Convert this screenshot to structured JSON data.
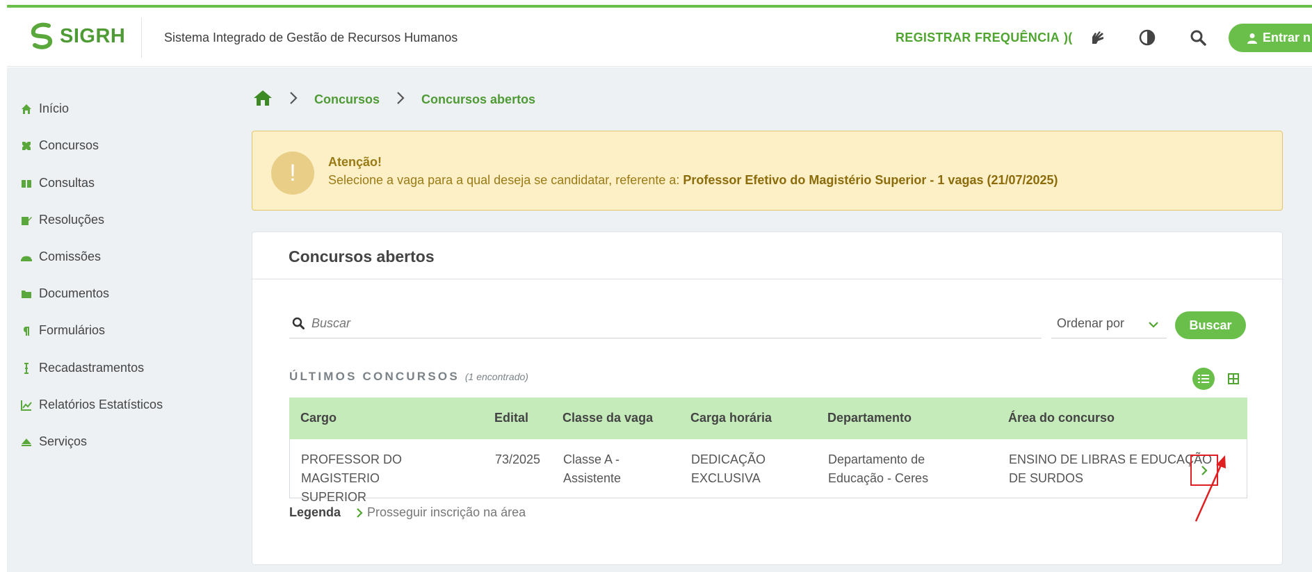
{
  "header": {
    "logo_text": "SIGRH",
    "system_name": "Sistema Integrado de Gestão de Recursos Humanos",
    "register_attendance": "REGISTRAR FREQUÊNCIA",
    "register_glyph": ")(",
    "login_label": "Entrar n",
    "accent": "#6abf4b"
  },
  "sidebar": {
    "items": [
      {
        "label": "Início",
        "icon": "home-icon"
      },
      {
        "label": "Concursos",
        "icon": "tools-icon"
      },
      {
        "label": "Consultas",
        "icon": "book-icon"
      },
      {
        "label": "Resoluções",
        "icon": "edit-icon"
      },
      {
        "label": "Comissões",
        "icon": "hat-icon"
      },
      {
        "label": "Documentos",
        "icon": "folder-icon"
      },
      {
        "label": "Formulários",
        "icon": "paragraph-icon"
      },
      {
        "label": "Recadastramentos",
        "icon": "cursor-icon"
      },
      {
        "label": "Relatórios Estatísticos",
        "icon": "chart-icon"
      },
      {
        "label": "Serviços",
        "icon": "eject-icon"
      }
    ]
  },
  "breadcrumb": {
    "items": [
      "Concursos",
      "Concursos abertos"
    ]
  },
  "alert": {
    "title": "Atenção!",
    "text": "Selecione a vaga para a qual deseja se candidatar, referente a: ",
    "highlight": "Professor Efetivo do Magistério Superior - 1 vagas (21/07/2025)"
  },
  "card": {
    "title": "Concursos abertos",
    "search_placeholder": "Buscar",
    "order_label": "Ordenar por",
    "search_button": "Buscar",
    "section_label": "ÚLTIMOS CONCURSOS",
    "section_count": "(1 encontrado)"
  },
  "table": {
    "headers": [
      "Cargo",
      "Edital",
      "Classe da vaga",
      "Carga horária",
      "Departamento",
      "Área do concurso"
    ],
    "rows": [
      {
        "cargo_1": "PROFESSOR DO MAGISTERIO",
        "cargo_2": "SUPERIOR",
        "edital": "73/2025",
        "classe_1": "Classe A -",
        "classe_2": "Assistente",
        "carga_1": "DEDICAÇÃO",
        "carga_2": "EXCLUSIVA",
        "depto_1": "Departamento de",
        "depto_2": "Educação - Ceres",
        "area_1": "ENSINO DE LIBRAS E EDUCAÇÃO",
        "area_2": "DE SURDOS"
      }
    ]
  },
  "legend": {
    "label": "Legenda",
    "text": "Prosseguir inscrição na área"
  }
}
